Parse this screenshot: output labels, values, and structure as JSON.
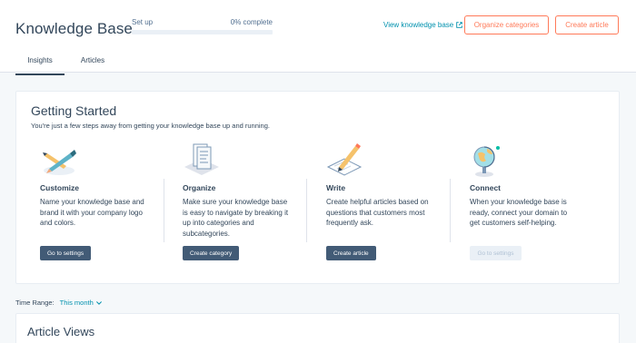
{
  "header": {
    "title": "Knowledge Base",
    "setup_label": "Set up",
    "setup_progress_text": "0% complete",
    "setup_progress": 0,
    "view_link": "View knowledge base",
    "organize_button": "Organize categories",
    "create_button": "Create article"
  },
  "tabs": [
    {
      "label": "Insights",
      "active": true
    },
    {
      "label": "Articles",
      "active": false
    }
  ],
  "getting_started": {
    "title": "Getting Started",
    "subtitle": "You're just a few steps away from getting your knowledge base up and running.",
    "steps": [
      {
        "heading": "Customize",
        "description": "Name your knowledge base and brand it with your company logo and colors.",
        "button": "Go to settings",
        "icon": "brush-pencil-icon",
        "button_disabled": false
      },
      {
        "heading": "Organize",
        "description": "Make sure your knowledge base is easy to navigate by breaking it up into categories and subcategories.",
        "button": "Create category",
        "icon": "document-stack-icon",
        "button_disabled": false
      },
      {
        "heading": "Write",
        "description": "Create helpful articles based on questions that customers most frequently ask.",
        "button": "Create article",
        "icon": "pencil-paper-icon",
        "button_disabled": false
      },
      {
        "heading": "Connect",
        "description": "When your knowledge base is ready, connect your domain to get customers self-helping.",
        "button": "Go to settings",
        "icon": "globe-icon",
        "button_disabled": true
      }
    ]
  },
  "time_range": {
    "label": "Time Range:",
    "value": "This month"
  },
  "article_views": {
    "title": "Article Views"
  },
  "colors": {
    "accent": "#ff7a59",
    "link": "#0091ae",
    "primary_button": "#425b76",
    "progress": "#00bda5"
  }
}
